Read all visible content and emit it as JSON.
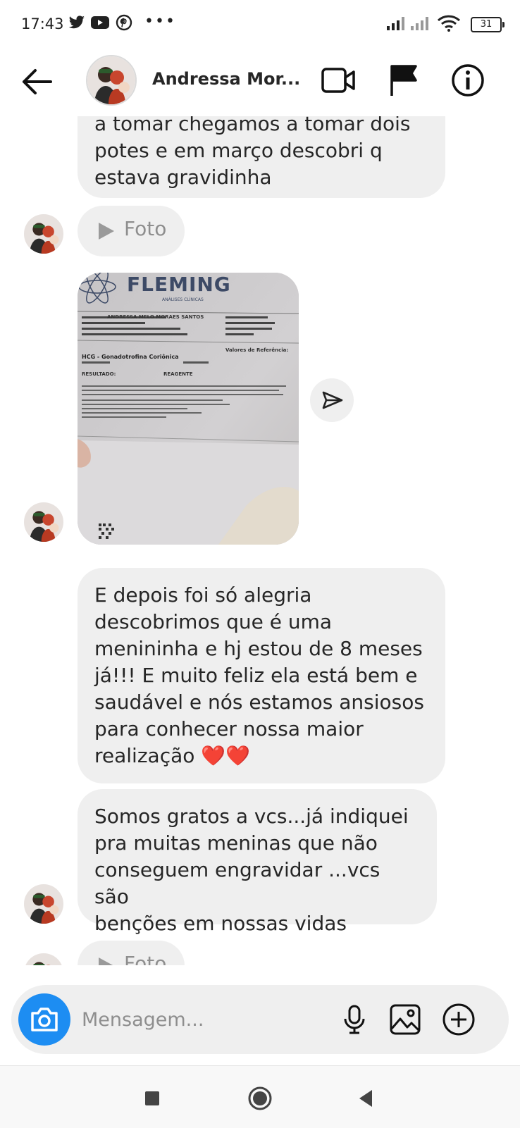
{
  "status_bar": {
    "time": "17:43",
    "battery": "31"
  },
  "header": {
    "name": "Andressa Mor..."
  },
  "messages": {
    "m1_lines": [
      "a tomar chegamos a tomar dois",
      "potes e em março descobri q",
      "estava gravidinha"
    ],
    "foto_label_1": "Foto",
    "m2_lines": [
      "E depois foi só alegria",
      "descobrimos que é uma",
      "menininha e hj estou de 8 meses",
      "já!!! E muito feliz ela está bem e",
      "saudável e nós estamos ansiosos",
      "para conhecer nossa maior",
      "realização ❤️❤️"
    ],
    "m3_lines": [
      "Somos gratos a vcs...já indiquei",
      "pra muitas meninas que não",
      "conseguem engravidar ...vcs são",
      "benções em nossas vidas"
    ],
    "foto_label_2": "Foto"
  },
  "photo_doc": {
    "lab_name": "FLEMING",
    "lab_sub": "ANÁLISES CLÍNICAS",
    "patient": "ANDRESSA MELO MORAES SANTOS",
    "exam": "HCG - Gonadotrofina Coriônica",
    "result_label": "RESULTADO:",
    "result": "REAGENTE",
    "ref_label": "Valores de Referência:"
  },
  "composer": {
    "placeholder": "Mensagem..."
  },
  "colors": {
    "bubble": "#efefef",
    "camera": "#1d8df2",
    "heart": "#e0161e"
  }
}
